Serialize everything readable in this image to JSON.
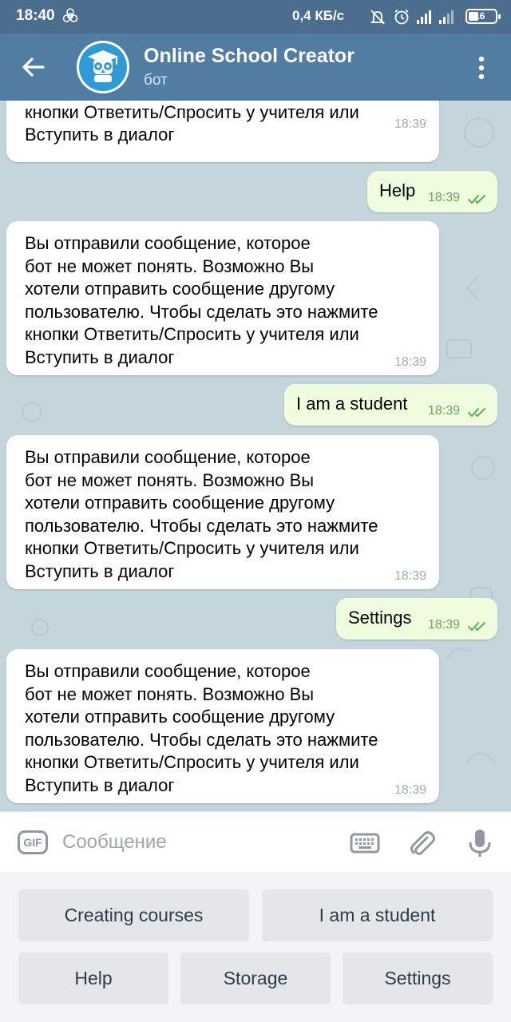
{
  "status_bar": {
    "time": "18:40",
    "network_speed": "0,4 КБ/с",
    "battery": "16"
  },
  "header": {
    "title": "Online School Creator",
    "subtitle": "бот"
  },
  "messages": [
    {
      "direction": "in",
      "text": "пользователю. Чтобы сделать это нажмите\nкнопки Ответить/Спросить у учителя или\nВступить в диалог",
      "time": "18:39"
    },
    {
      "direction": "out",
      "text": "Help",
      "time": "18:39"
    },
    {
      "direction": "in",
      "text": "Вы отправили сообщение, которое\nбот не может понять. Возможно Вы\nхотели отправить сообщение другому\nпользователю. Чтобы сделать это нажмите\nкнопки Ответить/Спросить у учителя или\nВступить в диалог",
      "time": "18:39"
    },
    {
      "direction": "out",
      "text": "I am a student",
      "time": "18:39"
    },
    {
      "direction": "in",
      "text": "Вы отправили сообщение, которое\nбот не может понять. Возможно Вы\nхотели отправить сообщение другому\nпользователю. Чтобы сделать это нажмите\nкнопки Ответить/Спросить у учителя или\nВступить в диалог",
      "time": "18:39"
    },
    {
      "direction": "out",
      "text": "Settings",
      "time": "18:39"
    },
    {
      "direction": "in",
      "text": "Вы отправили сообщение, которое\nбот не может понять. Возможно Вы\nхотели отправить сообщение другому\nпользователю. Чтобы сделать это нажмите\nкнопки Ответить/Спросить у учителя или\nВступить в диалог",
      "time": "18:39"
    }
  ],
  "input": {
    "gif_label": "GIF",
    "placeholder": "Сообщение",
    "value": ""
  },
  "keyboard": {
    "rows": [
      [
        "Creating courses",
        "I am a student"
      ],
      [
        "Help",
        "Storage",
        "Settings"
      ]
    ]
  },
  "icons": {
    "status": [
      "biohazard-icon",
      "mute-icon",
      "alarm-icon",
      "signal-icon",
      "signal-icon",
      "wifi-icon",
      "battery-icon"
    ],
    "header": [
      "back-arrow-icon",
      "bot-avatar",
      "more-vertical-icon"
    ],
    "input": [
      "gif-icon",
      "keyboard-icon",
      "attach-icon",
      "microphone-icon"
    ],
    "read_receipt": "double-check-icon"
  },
  "colors": {
    "header": "#527da3",
    "status_bar": "#4b6e8f",
    "chat_background": "#c4d5dc",
    "incoming_bubble": "#ffffff",
    "outgoing_bubble": "#effdde",
    "read_check": "#5eb056"
  }
}
